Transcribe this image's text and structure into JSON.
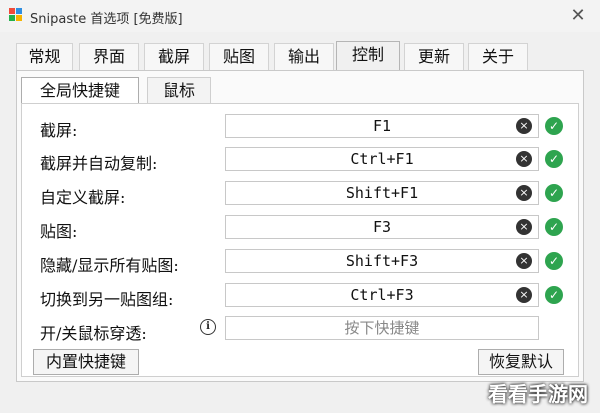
{
  "window": {
    "title": "Snipaste 首选项 [免费版]",
    "close_label": "✕"
  },
  "tabs": [
    {
      "label": "常规"
    },
    {
      "label": "界面"
    },
    {
      "label": "截屏"
    },
    {
      "label": "贴图"
    },
    {
      "label": "输出"
    },
    {
      "label": "控制",
      "active": true
    },
    {
      "label": "更新"
    },
    {
      "label": "关于"
    }
  ],
  "subtabs": [
    {
      "label": "全局快捷键",
      "active": true
    },
    {
      "label": "鼠标"
    }
  ],
  "hotkeys": [
    {
      "label": "截屏:",
      "value": "F1"
    },
    {
      "label": "截屏并自动复制:",
      "value": "Ctrl+F1"
    },
    {
      "label": "自定义截屏:",
      "value": "Shift+F1"
    },
    {
      "label": "贴图:",
      "value": "F3"
    },
    {
      "label": "隐藏/显示所有贴图:",
      "value": "Shift+F3"
    },
    {
      "label": "切换到另一贴图组:",
      "value": "Ctrl+F3"
    }
  ],
  "mouse_toggle": {
    "label": "开/关鼠标穿透:",
    "placeholder": "按下快捷键",
    "info_icon": "i"
  },
  "buttons": {
    "builtin": "内置快捷键",
    "restore": "恢复默认"
  },
  "icons": {
    "clear": "×",
    "ok": "✓"
  },
  "watermark": "看看手游网",
  "colors": {
    "ok_green": "#2ea44f"
  }
}
